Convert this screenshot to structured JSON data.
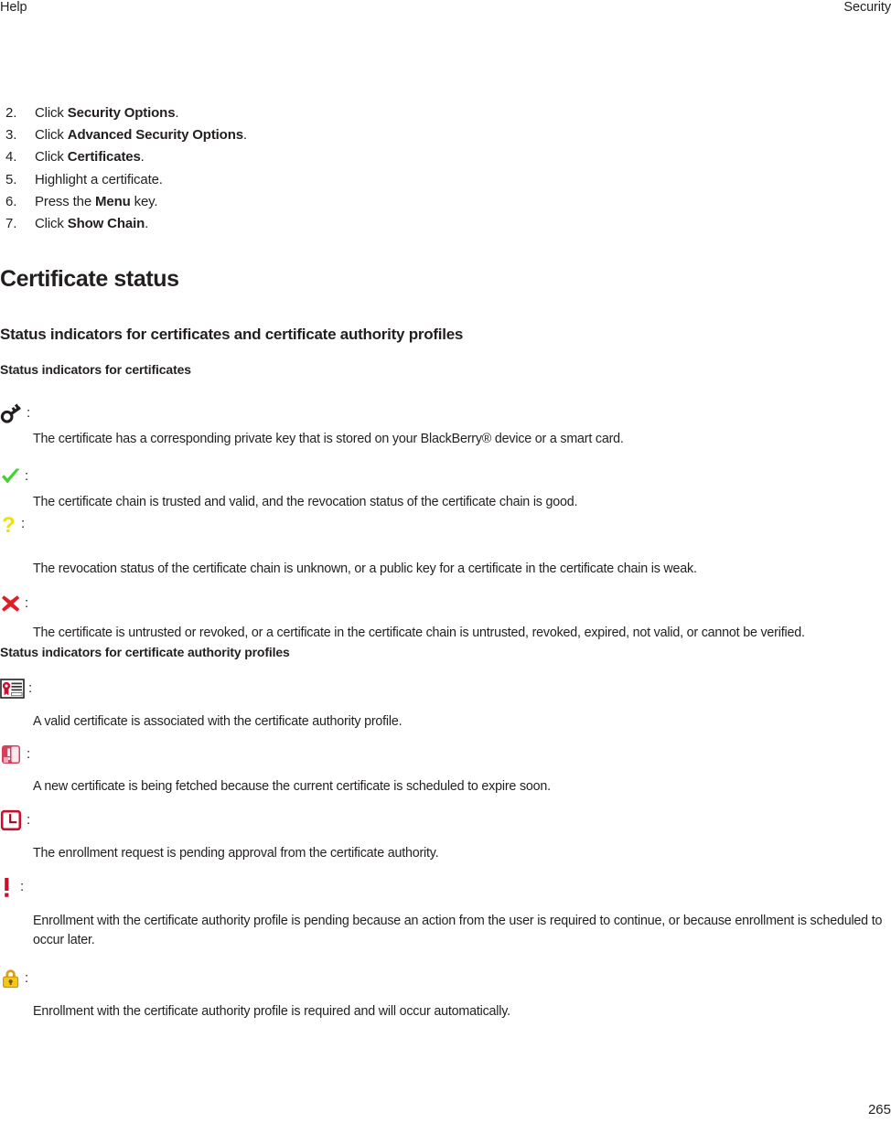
{
  "header": {
    "left": "Help",
    "right": "Security"
  },
  "steps": [
    {
      "num": "2.",
      "pre": "Click ",
      "bold": "Security Options",
      "post": "."
    },
    {
      "num": "3.",
      "pre": "Click ",
      "bold": "Advanced Security Options",
      "post": "."
    },
    {
      "num": "4.",
      "pre": "Click ",
      "bold": "Certificates",
      "post": "."
    },
    {
      "num": "5.",
      "pre": "Highlight a certificate.",
      "bold": "",
      "post": ""
    },
    {
      "num": "6.",
      "pre": "Press the ",
      "bold": "Menu",
      "post": " key."
    },
    {
      "num": "7.",
      "pre": "Click ",
      "bold": "Show Chain",
      "post": "."
    }
  ],
  "headings": {
    "main": "Certificate status",
    "sub": "Status indicators for certificates and certificate authority profiles",
    "group1": "Status indicators for certificates",
    "group2": "Status indicators for certificate authority profiles"
  },
  "colon": ":",
  "indicators_certificates": [
    {
      "icon": "key-icon",
      "color": "#231f20",
      "desc": "The certificate has a corresponding private key that is stored on your BlackBerry® device or a smart card."
    },
    {
      "icon": "check-mark-icon",
      "color": "#3fd32b",
      "desc": "The certificate chain is trusted and valid, and the revocation status of the certificate chain is good."
    },
    {
      "icon": "question-mark-icon",
      "color": "#eee000",
      "desc": "The revocation status of the certificate chain is unknown, or a public key for a certificate in the certificate chain is weak."
    },
    {
      "icon": "cross-mark-icon",
      "color": "#e31d25",
      "desc": "The certificate is untrusted or revoked, or a certificate in the certificate chain is untrusted, revoked, expired, not valid, or cannot be verified."
    }
  ],
  "indicators_ca_profiles": [
    {
      "icon": "certificate-document-icon",
      "color": "#c8102e",
      "desc": "A valid certificate is associated with the certificate authority profile."
    },
    {
      "icon": "certificate-fetching-icon",
      "color": "#d6405c",
      "desc": "A new certificate is being fetched because the current certificate is scheduled to expire soon."
    },
    {
      "icon": "clock-pending-icon",
      "color": "#c8102e",
      "desc": "The enrollment request is pending approval from the certificate authority."
    },
    {
      "icon": "exclamation-mark-icon",
      "color": "#c8102e",
      "desc": "Enrollment with the certificate authority profile is pending because an action from the user is required to continue, or because enrollment is scheduled to occur later."
    },
    {
      "icon": "padlock-icon",
      "color": "#f5c518",
      "desc": "Enrollment with the certificate authority profile is required and will occur automatically."
    }
  ],
  "page_number": "265"
}
